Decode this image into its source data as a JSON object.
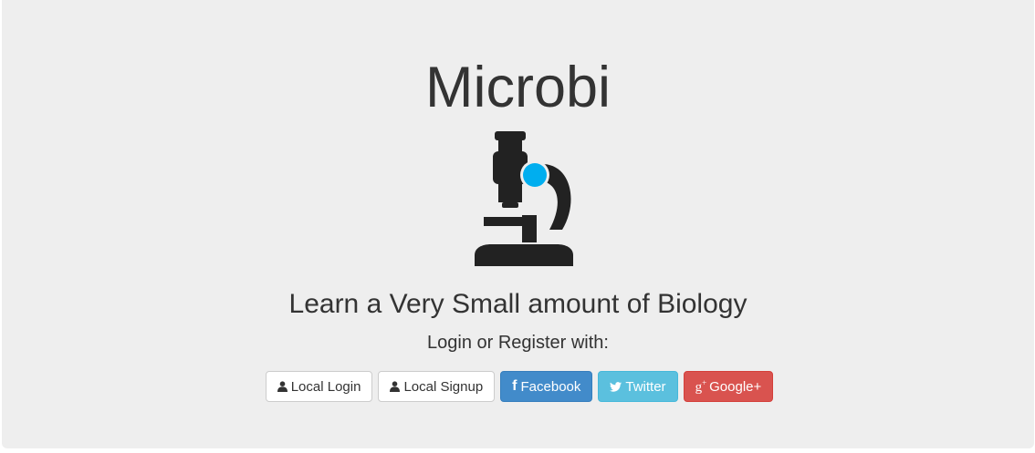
{
  "app": {
    "title": "Microbi",
    "tagline": "Learn a Very Small amount of Biology",
    "prompt": "Login or Register with:"
  },
  "logo": {
    "icon": "microscope-icon",
    "body_color": "#222222",
    "lens_color": "#00aeef"
  },
  "buttons": {
    "local_login": {
      "label": "Local Login",
      "icon": "user-icon"
    },
    "local_signup": {
      "label": "Local Signup",
      "icon": "user-icon"
    },
    "facebook": {
      "label": "Facebook",
      "icon": "facebook-icon",
      "color": "#428bca"
    },
    "twitter": {
      "label": "Twitter",
      "icon": "twitter-icon",
      "color": "#5bc0de"
    },
    "google": {
      "label": "Google+",
      "icon": "google-plus-icon",
      "color": "#d9534f"
    }
  }
}
